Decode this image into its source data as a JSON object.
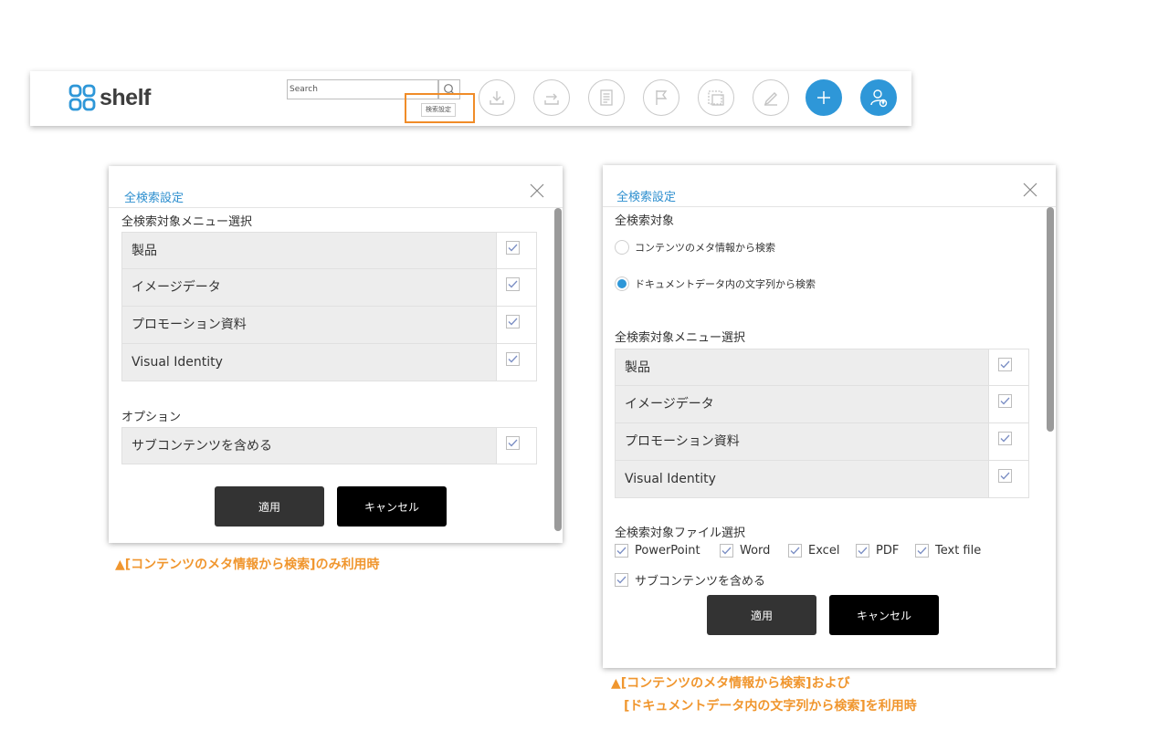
{
  "header": {
    "logo_text": "shelf",
    "search_placeholder": "Search",
    "search_settings_label": "検索設定",
    "icons": [
      "download-icon",
      "share-icon",
      "document-icon",
      "flag-icon",
      "frame-icon",
      "edit-icon",
      "plus-icon",
      "user-settings-icon"
    ]
  },
  "dialog_left": {
    "title": "全検索設定",
    "menu_section_label": "全検索対象メニュー選択",
    "menu_items": [
      {
        "label": "製品",
        "checked": true
      },
      {
        "label": "イメージデータ",
        "checked": true
      },
      {
        "label": "プロモーション資料",
        "checked": true
      },
      {
        "label": "Visual Identity",
        "checked": true
      }
    ],
    "option_section_label": "オプション",
    "option_items": [
      {
        "label": "サブコンテンツを含める",
        "checked": true
      }
    ],
    "apply_label": "適用",
    "cancel_label": "キャンセル"
  },
  "dialog_right": {
    "title": "全検索設定",
    "target_section_label": "全検索対象",
    "radio_options": [
      {
        "label": "コンテンツのメタ情報から検索",
        "selected": false
      },
      {
        "label": "ドキュメントデータ内の文字列から検索",
        "selected": true
      }
    ],
    "menu_section_label": "全検索対象メニュー選択",
    "menu_items": [
      {
        "label": "製品",
        "checked": true
      },
      {
        "label": "イメージデータ",
        "checked": true
      },
      {
        "label": "プロモーション資料",
        "checked": true
      },
      {
        "label": "Visual Identity",
        "checked": true
      }
    ],
    "file_section_label": "全検索対象ファイル選択",
    "file_types": [
      {
        "label": "PowerPoint",
        "checked": true
      },
      {
        "label": "Word",
        "checked": true
      },
      {
        "label": "Excel",
        "checked": true
      },
      {
        "label": "PDF",
        "checked": true
      },
      {
        "label": "Text file",
        "checked": true
      }
    ],
    "subcontent_label": "サブコンテンツを含める",
    "subcontent_checked": true,
    "apply_label": "適用",
    "cancel_label": "キャンセル"
  },
  "captions": {
    "left": "▲[コンテンツのメタ情報から検索]のみ利用時",
    "right_line1": "▲[コンテンツのメタ情報から検索]および",
    "right_line2": "[ドキュメントデータ内の文字列から検索]を利用時"
  },
  "colors": {
    "accent_blue": "#2e97d8",
    "highlight_orange": "#f08c28",
    "caption_orange": "#f0962e",
    "title_blue": "#2e8fcf"
  }
}
